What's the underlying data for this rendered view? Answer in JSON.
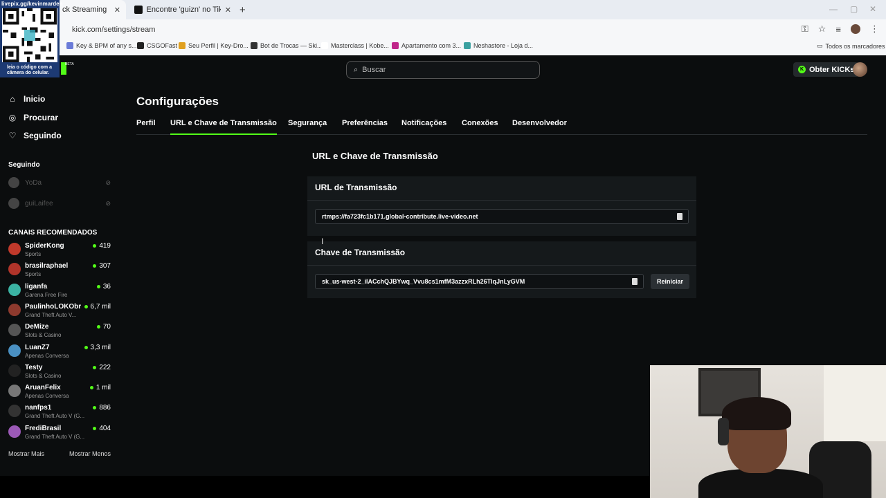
{
  "browser": {
    "tabs": [
      {
        "label": "ck Streaming",
        "active": true
      },
      {
        "label": "Encontre 'guizn' no TikTok | Pe",
        "active": false
      }
    ],
    "url": "kick.com/settings/stream",
    "bookmarks": [
      "Key & BPM of any s...",
      "CSGOFast",
      "Seu Perfil | Key-Dro...",
      "Bot de Trocas — Ski...",
      "Masterclass | Kobe...",
      "Apartamento com 3...",
      "Neshastore - Loja d...",
      "Todos os marcadores"
    ]
  },
  "overlay_qr": {
    "top_text": "livepix.gg/kevinmarden",
    "bottom_text_1": "leia o código com a",
    "bottom_text_2": "câmera do celular."
  },
  "header": {
    "beta": "BETA",
    "search_placeholder": "Buscar",
    "kicks_label": "Obter KICKs"
  },
  "sidebar": {
    "nav": [
      {
        "label": "Inicio",
        "icon": "home-icon"
      },
      {
        "label": "Procurar",
        "icon": "compass-icon"
      },
      {
        "label": "Seguindo",
        "icon": "heart-icon"
      }
    ],
    "following_title": "Seguindo",
    "following": [
      {
        "name": "YoDa"
      },
      {
        "name": "guiLaifee"
      }
    ],
    "recommended_title": "CANAIS RECOMENDADOS",
    "channels": [
      {
        "name": "SpiderKong",
        "category": "Sports",
        "viewers": "419",
        "color": "#c0392b"
      },
      {
        "name": "brasilraphael",
        "category": "Sports",
        "viewers": "307",
        "color": "#b0342a"
      },
      {
        "name": "liganfa",
        "category": "Garena Free Fire",
        "viewers": "36",
        "color": "#3bb3a3"
      },
      {
        "name": "PaulinhoLOKObr",
        "category": "Grand Theft Auto V...",
        "viewers": "6,7 mil",
        "color": "#8e3a2e"
      },
      {
        "name": "DeMize",
        "category": "Slots & Casino",
        "viewers": "70",
        "color": "#555"
      },
      {
        "name": "LuanZ7",
        "category": "Apenas Conversa",
        "viewers": "3,3 mil",
        "color": "#4a90c2"
      },
      {
        "name": "Testy",
        "category": "Slots & Casino",
        "viewers": "222",
        "color": "#222"
      },
      {
        "name": "AruanFelix",
        "category": "Apenas Conversa",
        "viewers": "1 mil",
        "color": "#777"
      },
      {
        "name": "nanfps1",
        "category": "Grand Theft Auto V (G...",
        "viewers": "886",
        "color": "#333"
      },
      {
        "name": "FrediBrasil",
        "category": "Grand Theft Auto V (G...",
        "viewers": "404",
        "color": "#9b59b6"
      }
    ],
    "show_more": "Mostrar Mais",
    "show_less": "Mostrar Menos"
  },
  "page": {
    "title": "Configurações",
    "tabs": [
      "Perfil",
      "URL e Chave de Transmissão",
      "Segurança",
      "Preferências",
      "Notificações",
      "Conexões",
      "Desenvolvedor"
    ],
    "active_tab": "URL e Chave de Transmissão",
    "section_title": "URL e Chave de Transmissão",
    "url_card_title": "URL de Transmissão",
    "stream_url": "rtmps://fa723fc1b171.global-contribute.live-video.net",
    "key_card_title": "Chave de Transmissão",
    "stream_key": "sk_us-west-2_ilACchQJBYwq_Vvu8cs1mfM3azzxRLh26TlqJnLyGVM",
    "reset_label": "Reiniciar"
  },
  "colors": {
    "accent": "#53fc18",
    "background": "#0b0d0e",
    "card": "#15191b"
  }
}
